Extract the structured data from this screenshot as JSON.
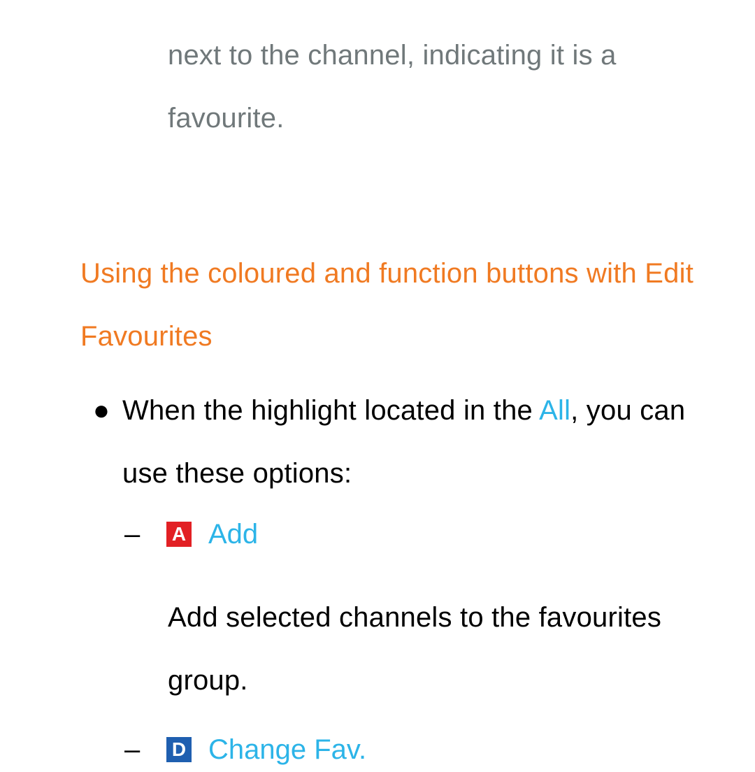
{
  "fragment": "next to the channel, indicating it is a favourite.",
  "section_heading": "Using the coloured and function buttons with Edit Favourites",
  "bullet": {
    "dot": "●",
    "lead": "When the highlight located in the ",
    "all": "All",
    "tail": ", you can use these options:"
  },
  "sub_items": [
    {
      "dash": "–",
      "key_letter": "A",
      "label": "Add",
      "description": "Add selected channels to the favourites group."
    },
    {
      "dash": "–",
      "key_letter": "D",
      "label": "Change Fav."
    }
  ]
}
